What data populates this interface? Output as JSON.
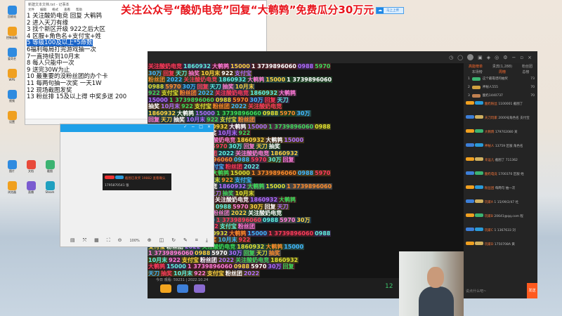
{
  "banner": "关注公众号“酸奶电竞”回复“大鹌鹑”免费瓜分30万元",
  "badge": "马上上传",
  "desktop_icons": [
    "回收站",
    "此电脑",
    "网络",
    "控制面板",
    "快捷方式",
    "腾讯QQ",
    "爱奇艺",
    "微信",
    "迅雷",
    "WPS",
    "Microsoft Edge",
    "文件夹",
    "视频",
    "游戏",
    "工具",
    "设置",
    "QQ音乐",
    "网易",
    "图片",
    "文档",
    "截图",
    "浏览器",
    "直播",
    "Steam"
  ],
  "notepad": {
    "title": "新建文本文档.txt - 记事本",
    "menu": [
      "文件",
      "编辑",
      "格式",
      "查看",
      "帮助"
    ],
    "lines": [
      "1 关注酸奶电竞 回复 大鹌鹑",
      "2 进入天刀有缘",
      "3 找个新区开级 922之后大区",
      "4 区服+角色名+支付宝+姓",
      "5 等级100及以上*5命数",
      "6福利每局打完游戏抽一次",
      "7一直持续到10月末",
      "8 每人只能中一次",
      "9 送完30W为止",
      "10 最重要的没粉丝团的办个卡",
      "11 每两句抽一次奖 一天1W",
      "12 现场截图发奖",
      "13 粉丝排 15及以上得 中奖多送 200"
    ],
    "selected_line": 4,
    "status": [
      "第5行，第1列",
      "100%",
      "Windows (CRLF)",
      "UTF-8"
    ]
  },
  "stream": {
    "danmaku": [
      "关注酸奶电竞",
      "1860932",
      "大鹌鹑",
      "15000",
      "1 3739896060",
      "0988",
      "5970",
      "30万",
      "回复",
      "天刀",
      "抽奖",
      "10月末",
      "922",
      "支付宝",
      "粉丝团",
      "2022"
    ],
    "info": "今日 观看: 59231 | 2022.10.24",
    "count": "12",
    "bottom_icons": [
      "trophy-icon",
      "gift-icon",
      "horse-icon"
    ]
  },
  "chat": {
    "tabs": [
      "高能榜单",
      "贵宾(1,288)",
      "粉丝团"
    ],
    "subtabs": [
      "本场榜",
      "周榜",
      "总榜"
    ],
    "ranks": [
      {
        "n": "1",
        "name": "这个最靠谱的抽奖",
        "v": "73"
      },
      {
        "n": "2",
        "name": "神秘人555",
        "v": "70"
      },
      {
        "n": "3",
        "name": "酸奶1440737",
        "v": "70"
      }
    ],
    "messages": [
      {
        "user": "酸奶粉丝",
        "text": "1100001 截图了"
      },
      {
        "user": "天刀玩家",
        "text": "2000号角色名 支付宝"
      },
      {
        "user": "大鹌鹑",
        "text": "179702080 某"
      },
      {
        "user": "神秘人",
        "text": "13759 区服 角色名"
      },
      {
        "user": "幸运儿",
        "text": "截图了 711362"
      },
      {
        "user": "酸奶电竞",
        "text": "1700370 区服 姓"
      },
      {
        "user": "粉丝团",
        "text": "每两句 抽一次"
      },
      {
        "user": "玩家A",
        "text": "1 15/09/2/47 杜"
      },
      {
        "user": "玩家B",
        "text": "20641@qq.com 程"
      },
      {
        "user": "玩家C",
        "text": "1 1367633 刘"
      },
      {
        "user": "玩家D",
        "text": "1750708A 黄"
      }
    ],
    "input_placeholder": "说点什么吧~",
    "send": "发送"
  },
  "viewer": {
    "zoom": "100%",
    "shot_text": "截图已发奖 19882 查看确认",
    "shot_line2": "1795870541 张"
  }
}
